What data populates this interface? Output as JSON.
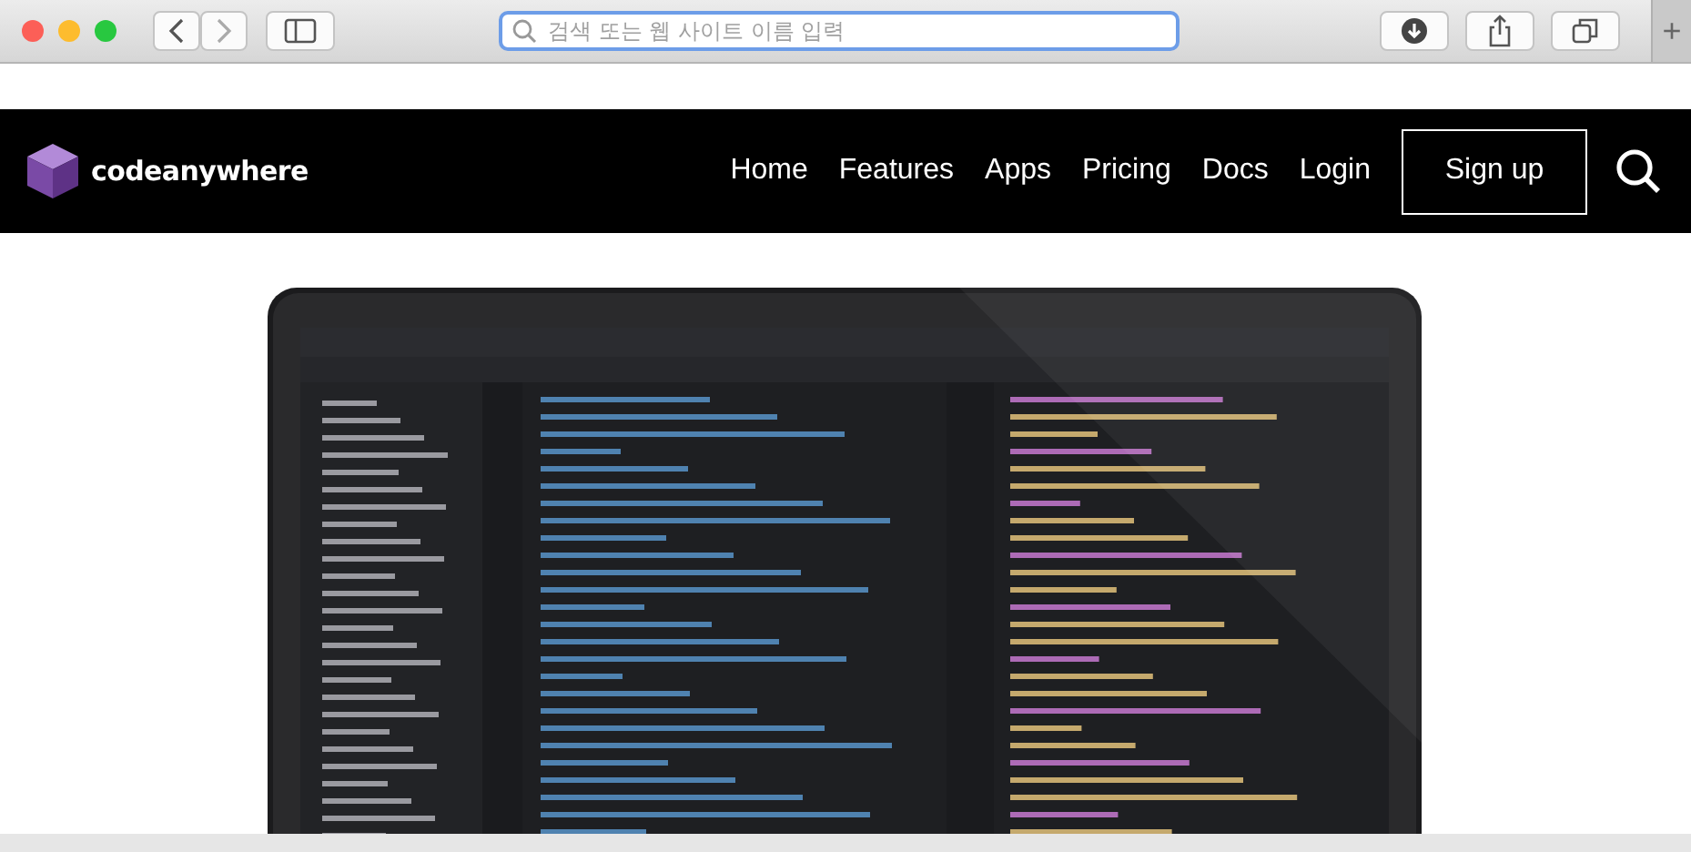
{
  "browser": {
    "address": {
      "placeholder": "검색 또는 웹 사이트 이름 입력"
    },
    "new_tab": "+"
  },
  "site": {
    "logo": "codeanywhere",
    "nav": [
      {
        "label": "Home"
      },
      {
        "label": "Features"
      },
      {
        "label": "Apps"
      },
      {
        "label": "Pricing"
      },
      {
        "label": "Docs"
      },
      {
        "label": "Login"
      }
    ],
    "signup": "Sign up"
  }
}
